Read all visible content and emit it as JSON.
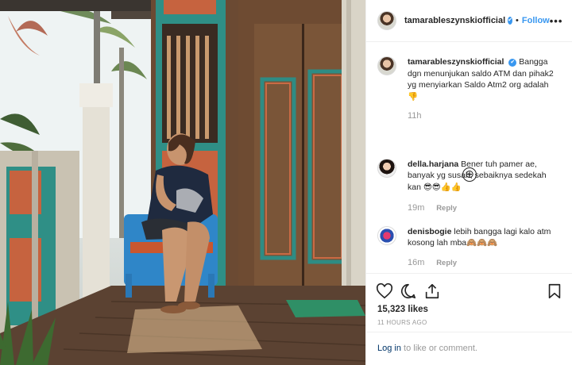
{
  "post": {
    "username": "tamarableszynskiofficial",
    "verified_icon": "✔",
    "separator": "•",
    "follow_label": "Follow",
    "more_label": "•••",
    "image_alt": "Woman sitting on a blue chair on a wooden porch in front of carved wooden doors"
  },
  "caption": {
    "username": "tamarableszynskiofficial",
    "text": "Bangga dgn menunjukan saldo ATM dan pihak2 yg menyiarkan Saldo Atm2 org adalah 👎",
    "time": "11h"
  },
  "comments": [
    {
      "username": "della.harjana",
      "text": "Bener tuh pamer ae, banyak yg susah, sebaiknya sedekah kan 😎😎👍👍",
      "time": "19m",
      "reply_label": "Reply"
    },
    {
      "username": "denisbogie",
      "text": "lebih bangga lagi kalo atm kosong lah mba🙈🙈🙈",
      "time": "16m",
      "reply_label": "Reply"
    }
  ],
  "load_more_icon": "⊕",
  "actions": {
    "likes": "15,323 likes",
    "time_ago": "11 HOURS AGO",
    "login_link": "Log in",
    "login_rest": " to like or comment."
  },
  "icons": [
    "heart-icon",
    "comment-icon",
    "share-icon",
    "bookmark-icon",
    "plus-circle-icon"
  ],
  "colors": {
    "accent": "#3897f0",
    "text": "#262626",
    "muted": "#999999",
    "link": "#003569",
    "border": "#efefef"
  }
}
